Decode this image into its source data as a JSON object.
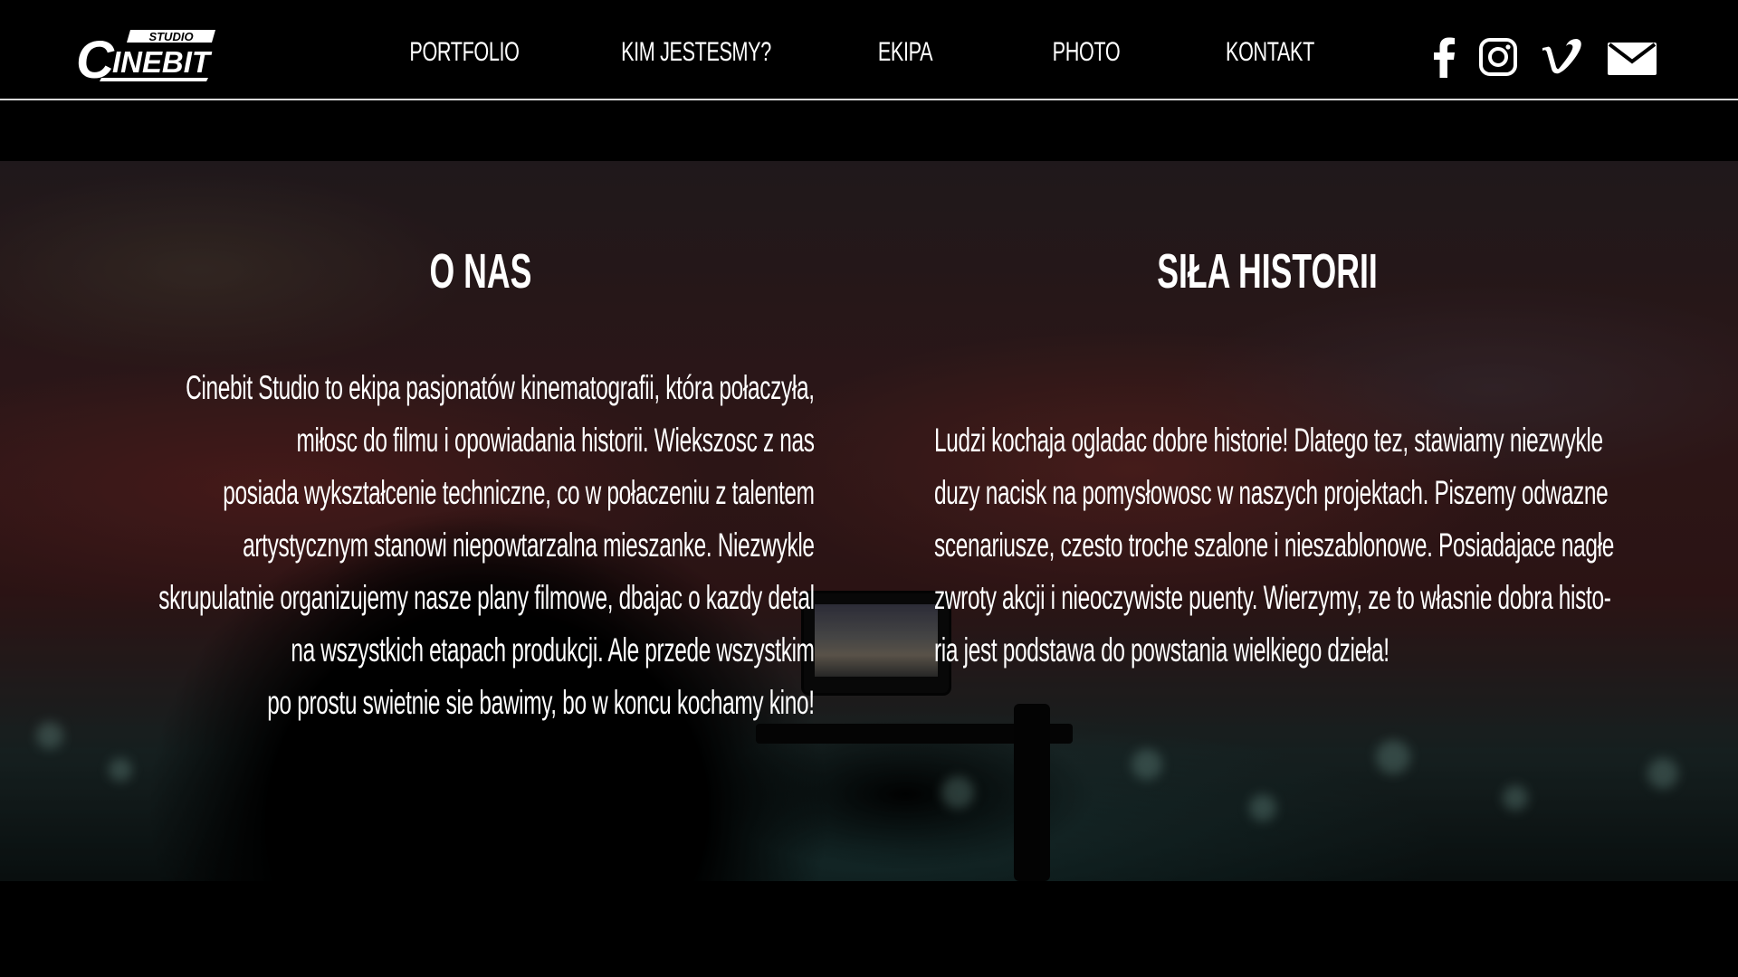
{
  "header": {
    "logo": {
      "top_text": "STUDIO",
      "main_text": "INEBIT",
      "initial": "C"
    },
    "nav": [
      {
        "label": "PORTFOLIO"
      },
      {
        "label": "KIM JESTESMY?"
      },
      {
        "label": "EKIPA"
      },
      {
        "label": "PHOTO"
      },
      {
        "label": "KONTAKT"
      }
    ],
    "social": [
      {
        "icon": "facebook-icon"
      },
      {
        "icon": "instagram-icon"
      },
      {
        "icon": "vimeo-icon"
      },
      {
        "icon": "mail-icon"
      }
    ]
  },
  "about": {
    "title": "O NAS",
    "lines": [
      "Cinebit Studio to ekipa pasjonatów kinematografii, która połaczyła,",
      "miłosc do filmu i opowiadania historii. Wiekszosc z nas",
      "posiada wykształcenie techniczne, co w połaczeniu z talentem",
      "artystycznym stanowi niepowtarzalna mieszanke. Niezwykle",
      "skrupulatnie organizujemy nasze plany filmowe, dbajac o kazdy detal",
      "na wszystkich etapach produkcji. Ale przede wszystkim",
      "po prostu swietnie sie  bawimy, bo w koncu kochamy kino!"
    ]
  },
  "story": {
    "title": "SIŁA HISTORII",
    "lines": [
      "Ludzi kochaja ogladac dobre historie! Dlatego tez, stawiamy niezwykle",
      "duzy nacisk na pomysłowosc w naszych projektach. Piszemy odwazne",
      "scenariusze, czesto troche szalone i nieszablonowe. Posiadajace nagłe",
      "zwroty akcji i nieoczywiste puenty. Wierzymy, ze to własnie dobra histo-",
      "ria jest podstawa do powstania wielkiego dzieła!"
    ]
  },
  "colors": {
    "background": "#000000",
    "text": "#ffffff",
    "divider": "#d8d8d8"
  }
}
